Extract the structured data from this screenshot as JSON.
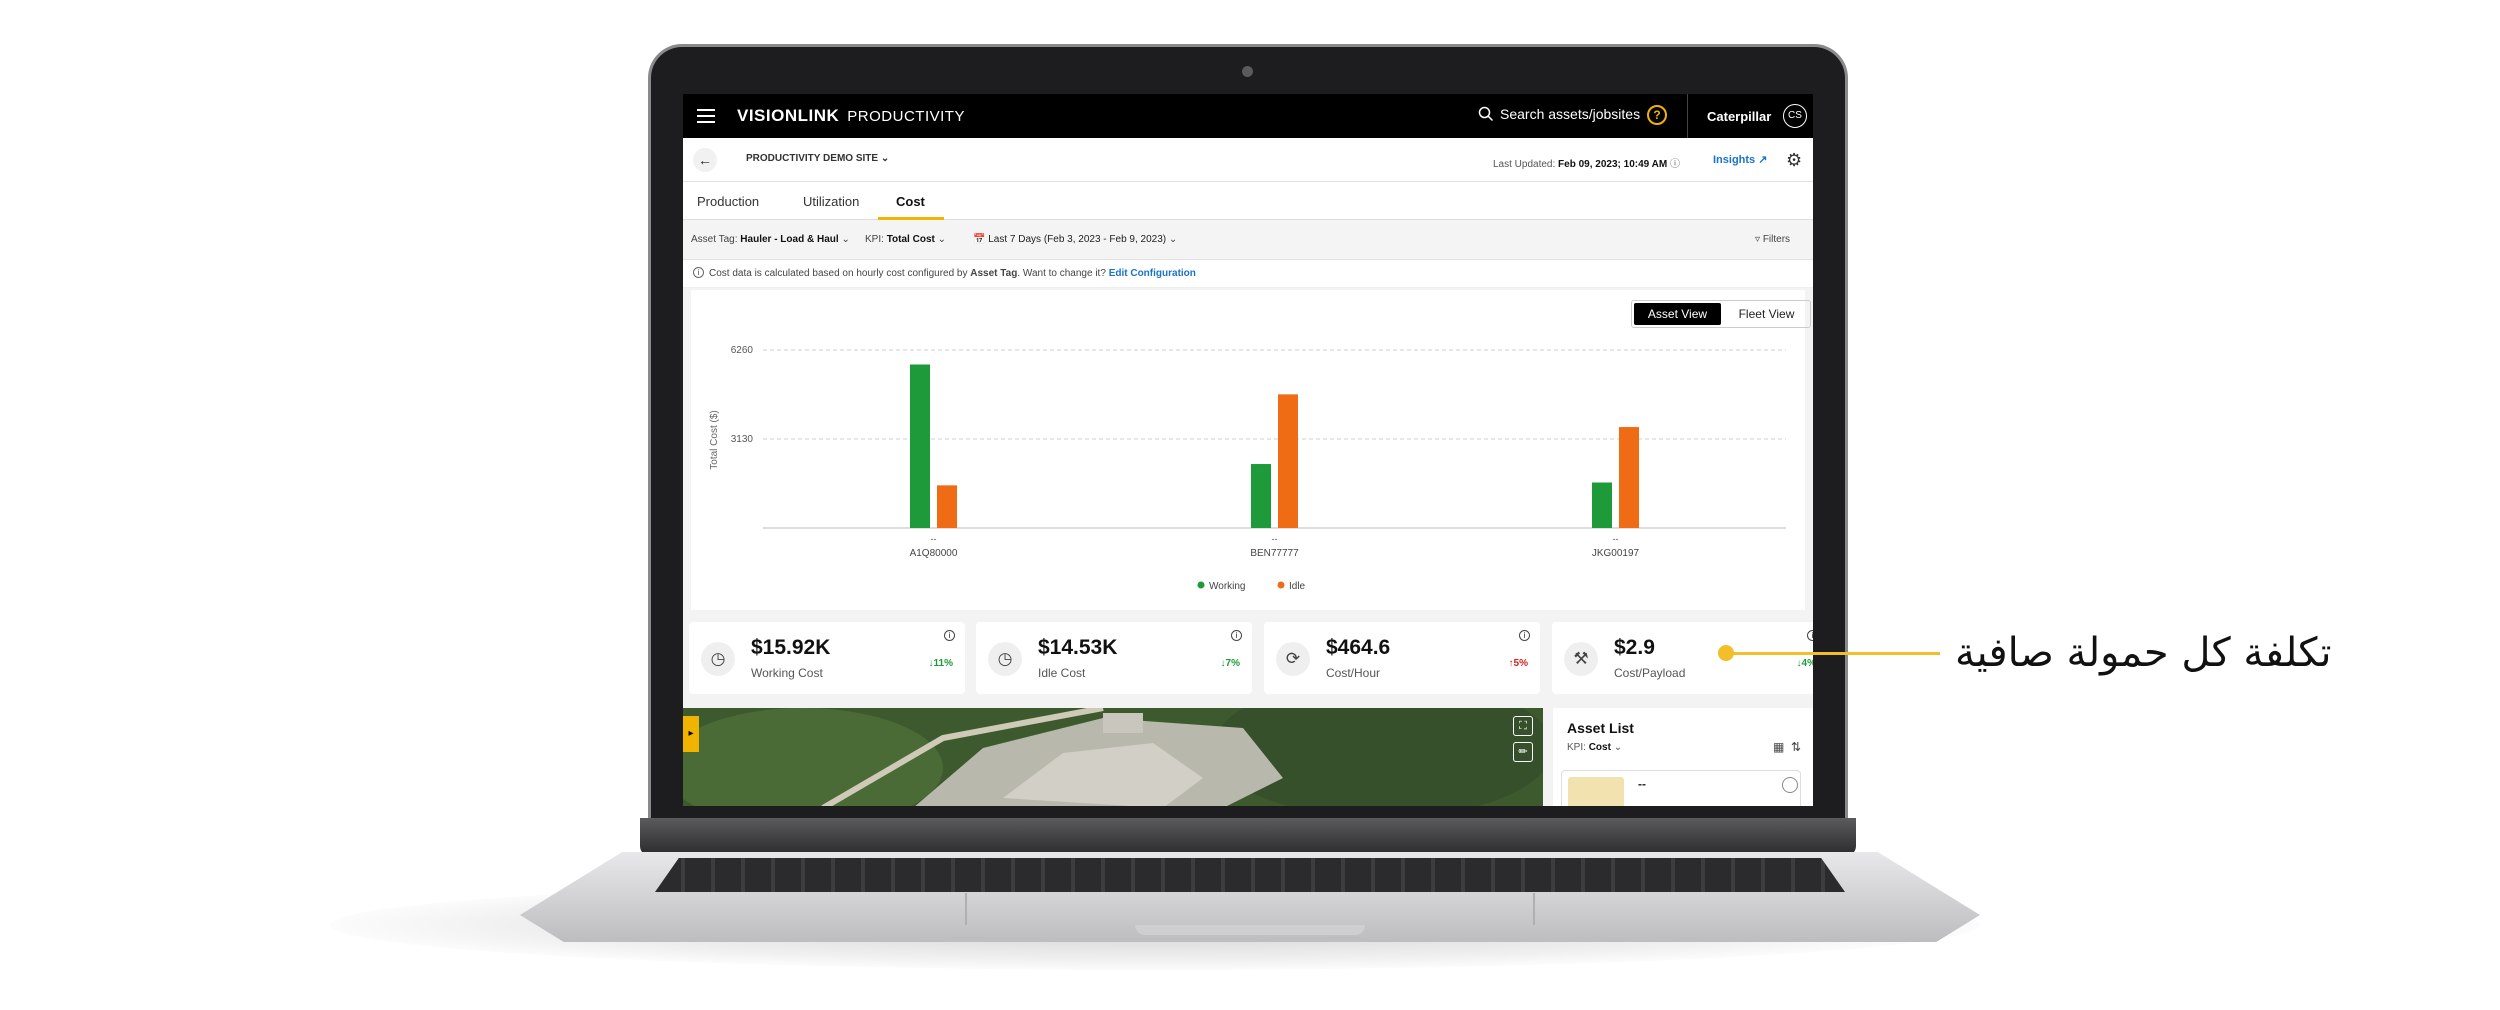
{
  "header": {
    "logo": "VISIONLINK",
    "product": "PRODUCTIVITY",
    "search_placeholder": "Search assets/jobsites",
    "org": "Caterpillar",
    "avatar_initials": "CS"
  },
  "subheader": {
    "site": "PRODUCTIVITY DEMO SITE",
    "last_updated_label": "Last Updated:",
    "last_updated_value": "Feb 09, 2023; 10:49 AM",
    "insights": "Insights"
  },
  "tabs": [
    {
      "label": "Production"
    },
    {
      "label": "Utilization"
    },
    {
      "label": "Cost",
      "active": true
    }
  ],
  "filters": {
    "asset_tag_label": "Asset Tag:",
    "asset_tag_value": "Hauler - Load & Haul",
    "kpi_label": "KPI:",
    "kpi_value": "Total Cost",
    "date_range": "Last 7 Days (Feb 3, 2023 - Feb 9, 2023)",
    "filters_button": "Filters"
  },
  "info": {
    "text_before": "Cost data is calculated based on hourly cost configured by ",
    "asset_tag_bold": "Asset Tag",
    "text_after": ". Want to change it? ",
    "edit_link": "Edit Configuration"
  },
  "view_toggle": {
    "asset_view": "Asset View",
    "fleet_view": "Fleet View"
  },
  "chart_data": {
    "type": "bar",
    "ylabel": "Total Cost ($)",
    "ylim": [
      0,
      6260
    ],
    "yticks": [
      3130,
      6260
    ],
    "categories": [
      "A1Q80000",
      "BEN77777",
      "JKG00197"
    ],
    "category_sublabels": [
      "--",
      "--",
      "--"
    ],
    "series": [
      {
        "name": "Working",
        "color": "#1e9a3a",
        "values": [
          5750,
          2250,
          1600
        ]
      },
      {
        "name": "Idle",
        "color": "#ef6c14",
        "values": [
          1500,
          4700,
          3550
        ]
      }
    ],
    "legend_position": "bottom",
    "grid": true
  },
  "kpis": [
    {
      "value": "$15.92K",
      "label": "Working Cost",
      "change": "11%",
      "direction": "down",
      "icon": "clock-icon"
    },
    {
      "value": "$14.53K",
      "label": "Idle Cost",
      "change": "7%",
      "direction": "down",
      "icon": "clock-icon"
    },
    {
      "value": "$464.6",
      "label": "Cost/Hour",
      "change": "5%",
      "direction": "up",
      "icon": "refresh-icon"
    },
    {
      "value": "$2.9",
      "label": "Cost/Payload",
      "change": "4%",
      "direction": "down",
      "icon": "payload-icon"
    }
  ],
  "asset_list": {
    "title": "Asset List",
    "kpi_label": "KPI:",
    "kpi_value": "Cost",
    "first_item": "--"
  },
  "callout": {
    "text": "تكلفة كل حمولة صافية"
  }
}
